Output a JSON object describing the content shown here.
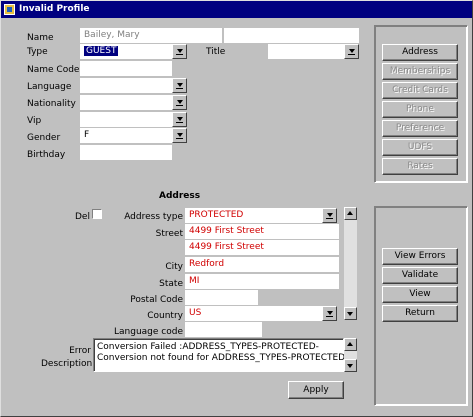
{
  "window": {
    "title": "Invalid Profile",
    "accent": "#000080"
  },
  "profile": {
    "name_label": "Name",
    "name_value": "Bailey, Mary",
    "type_label": "Type",
    "type_value": "GUEST",
    "title_label": "Title",
    "name_code_label": "Name Code",
    "language_label": "Language",
    "nationality_label": "Nationality",
    "vip_label": "Vip",
    "gender_label": "Gender",
    "gender_value": "F",
    "birthday_label": "Birthday"
  },
  "side_buttons_top": [
    {
      "label": "Address",
      "enabled": true
    },
    {
      "label": "Memberships",
      "enabled": false
    },
    {
      "label": "Credit Cards",
      "enabled": false
    },
    {
      "label": "Phone",
      "enabled": false
    },
    {
      "label": "Preference",
      "enabled": false
    },
    {
      "label": "UDFS",
      "enabled": false
    },
    {
      "label": "Rates",
      "enabled": false
    }
  ],
  "address": {
    "heading": "Address",
    "del_label": "Del",
    "type_label": "Address type",
    "type_value": "PROTECTED",
    "street_label": "Street",
    "street1": "4499 First Street",
    "street2": "4499 First Street",
    "city_label": "City",
    "city_value": "Redford",
    "state_label": "State",
    "state_value": "MI",
    "postal_label": "Postal Code",
    "country_label": "Country",
    "country_value": "US",
    "language_code_label": "Language code",
    "value_color": "#d00000"
  },
  "error": {
    "label_line1": "Error",
    "label_line2": "Description",
    "line1": "Conversion Failed :ADDRESS_TYPES-PROTECTED-",
    "line2": "Conversion not found for ADDRESS_TYPES-PROTECTED"
  },
  "side_buttons_bottom": [
    {
      "label": "View Errors"
    },
    {
      "label": "Validate"
    },
    {
      "label": "View"
    },
    {
      "label": "Return"
    }
  ],
  "apply_label": "Apply"
}
